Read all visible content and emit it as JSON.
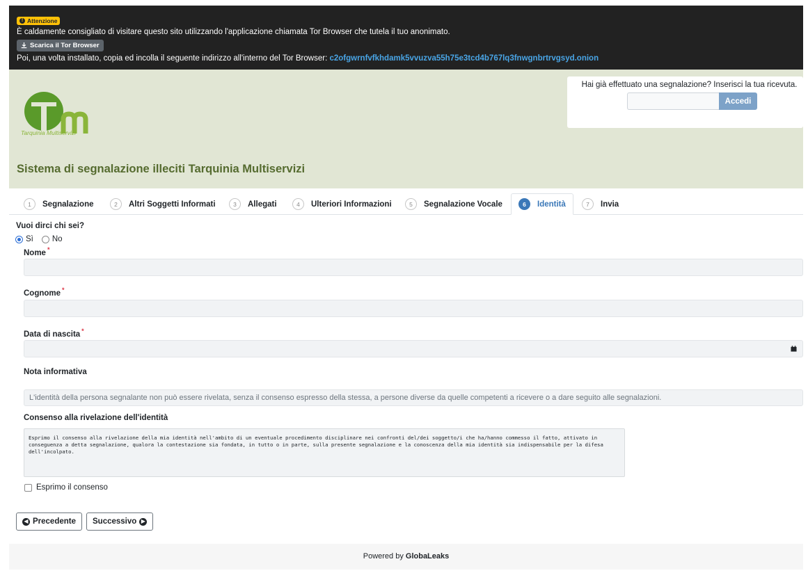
{
  "banner": {
    "badge": "Attenzione",
    "message": "È caldamente consigliato di visitare questo sito utilizzando l'applicazione chiamata Tor Browser che tutela il tuo anonimato.",
    "tor_button": "Scarica il Tor Browser",
    "instructions": "Poi, una volta installato, copia ed incolla il seguente indirizzo all'interno del Tor Browser:",
    "onion_address": "c2ofgwrnfvfkhdamk5vvuzva55h75e3tcd4b767lq3fnwgnbrtrvgsyd.onion"
  },
  "header": {
    "logo_text": "Tarquinia Multiservizi",
    "title": "Sistema di segnalazione illeciti Tarquinia Multiservizi",
    "receipt_prompt": "Hai già effettuato una segnalazione? Inserisci la tua ricevuta.",
    "receipt_placeholder": "",
    "login_button": "Accedi"
  },
  "tabs": [
    {
      "num": "1",
      "label": "Segnalazione",
      "active": false
    },
    {
      "num": "2",
      "label": "Altri Soggetti Informati",
      "active": false
    },
    {
      "num": "3",
      "label": "Allegati",
      "active": false
    },
    {
      "num": "4",
      "label": "Ulteriori Informazioni",
      "active": false
    },
    {
      "num": "5",
      "label": "Segnalazione Vocale",
      "active": false
    },
    {
      "num": "6",
      "label": "Identità",
      "active": true
    },
    {
      "num": "7",
      "label": "Invia",
      "active": false
    }
  ],
  "form": {
    "question": "Vuoi dirci chi sei?",
    "option_yes": "Sì",
    "option_no": "No",
    "name_label": "Nome",
    "surname_label": "Cognome",
    "birthdate_label": "Data di nascita",
    "required_mark": "*",
    "note_label": "Nota informativa",
    "note_text": "L'identità della persona segnalante non può essere rivelata, senza il consenso espresso della stessa, a persone diverse da quelle competenti a ricevere o a dare seguito alle segnalazioni.",
    "consent_label": "Consenso alla rivelazione dell'identità",
    "consent_text": "Esprimo il consenso alla rivelazione della mia identità nell'ambito di un eventuale procedimento disciplinare nei confronti del/dei soggetto/i che ha/hanno commesso il fatto, attivato in conseguenza a detta segnalazione, qualora la contestazione sia fondata, in tutto o in parte, sulla presente segnalazione e la conoscenza della mia identità sia indispensabile per la difesa dell'incolpato.",
    "consent_checkbox": "Esprimo il consenso"
  },
  "nav": {
    "previous": "Precedente",
    "next": "Successivo"
  },
  "footer": {
    "powered_by": "Powered by",
    "brand": "GlobaLeaks"
  },
  "colors": {
    "banner_bg": "#222222",
    "header_bg": "#e1e6d4",
    "accent": "#3b78b8",
    "logo_green": "#5a9a2a",
    "warning": "#ffc107"
  }
}
